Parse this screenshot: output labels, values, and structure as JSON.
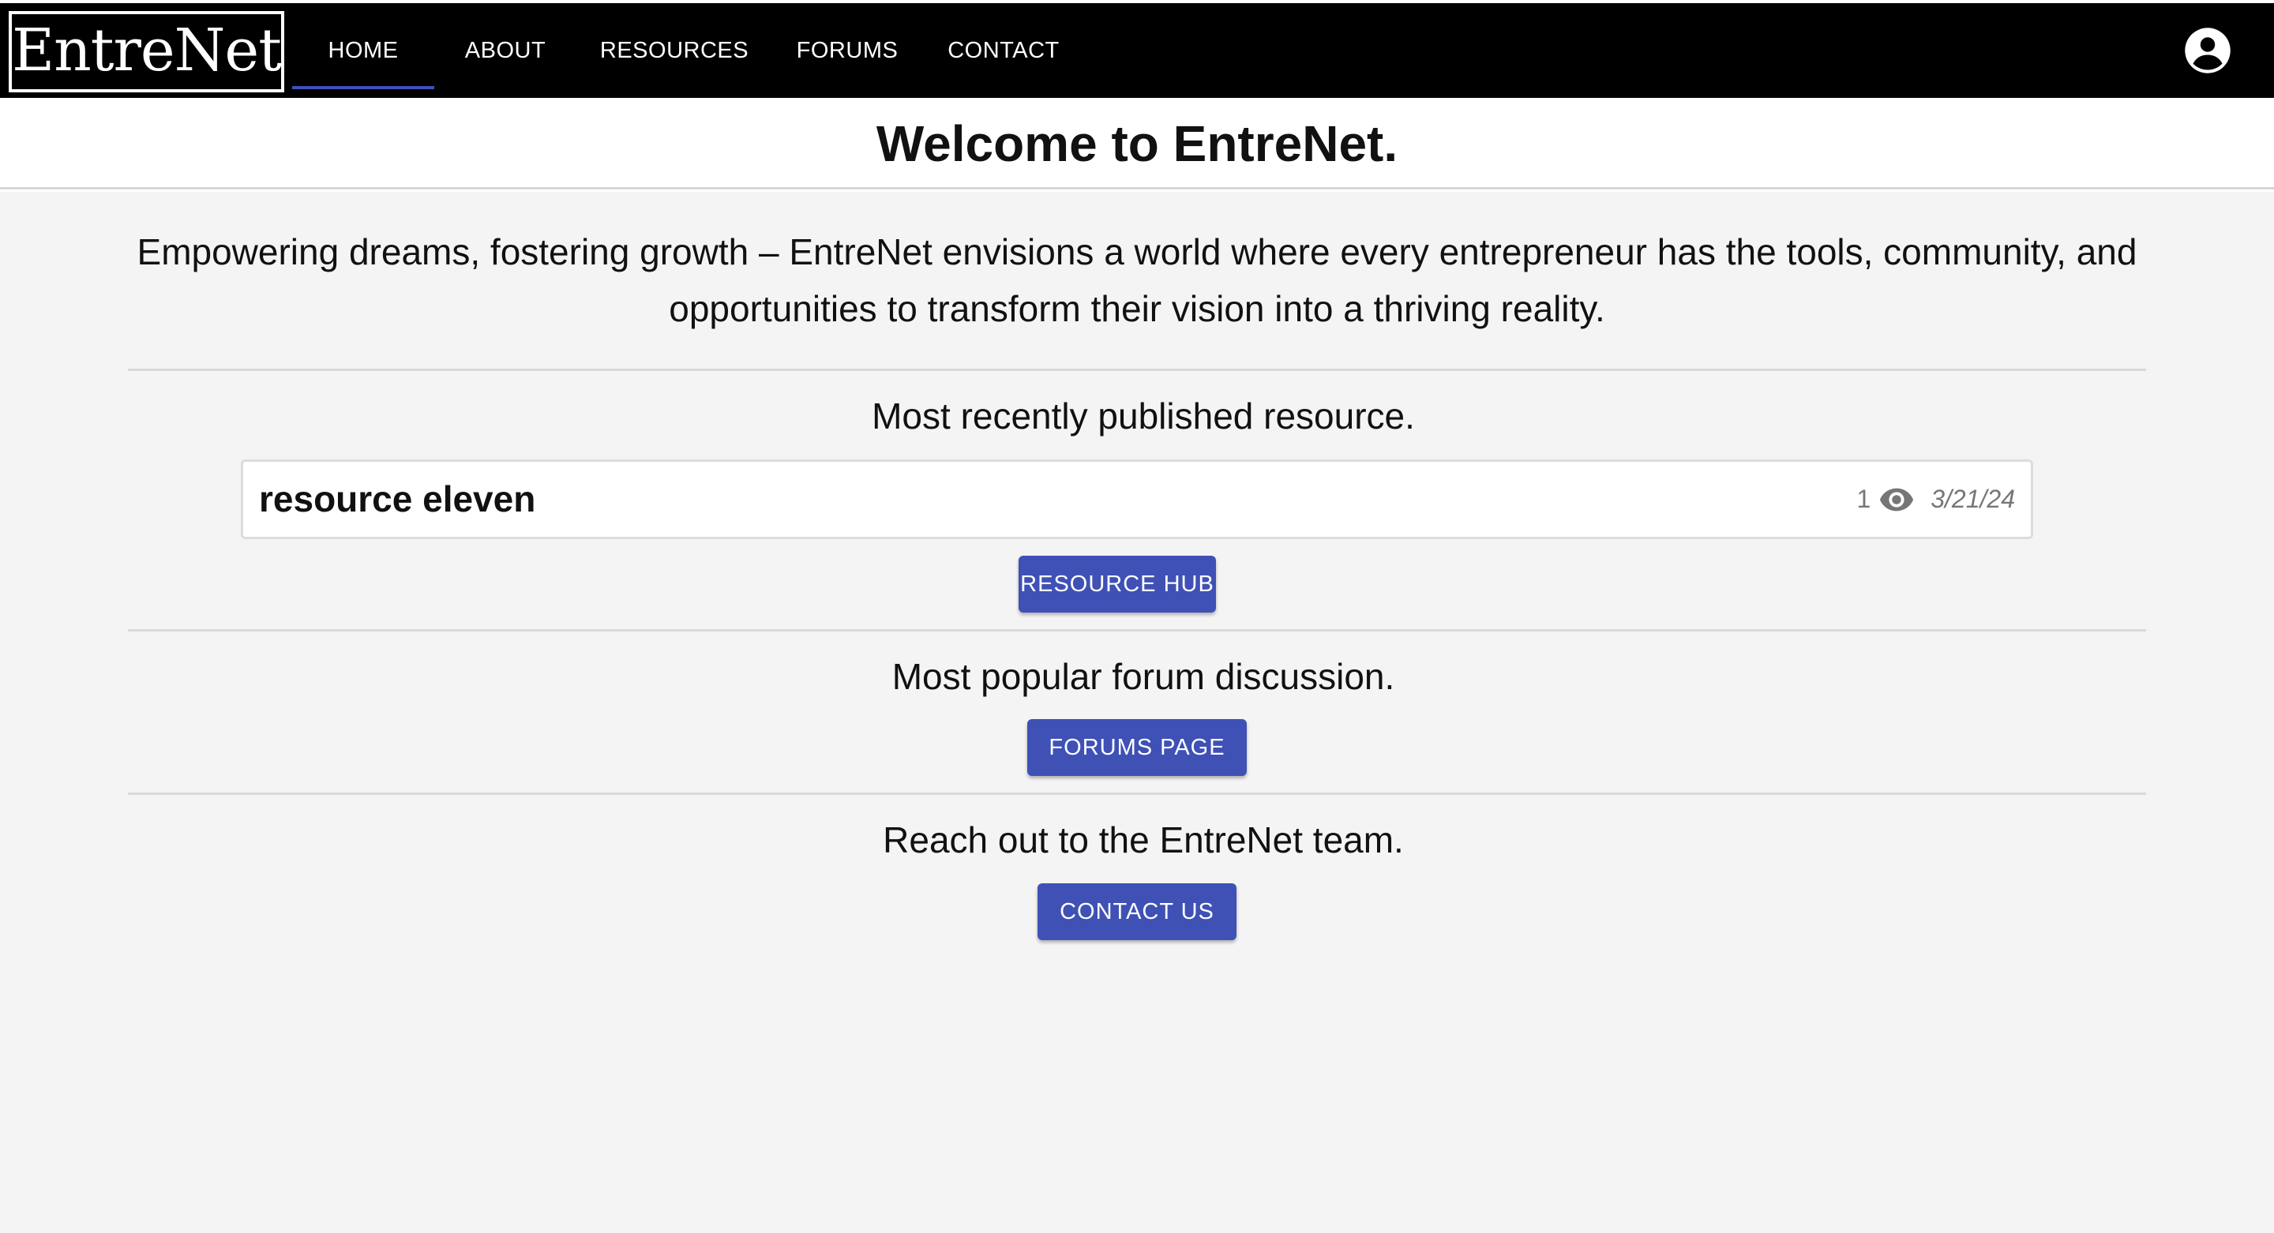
{
  "nav": {
    "logo": "EntreNet",
    "items": [
      "HOME",
      "ABOUT",
      "RESOURCES",
      "FORUMS",
      "CONTACT"
    ],
    "active": "HOME"
  },
  "header": {
    "title": "Welcome to EntreNet."
  },
  "main": {
    "mission": "Empowering dreams, fostering growth – EntreNet envisions a world where every entrepreneur has the tools, community, and opportunities to transform their vision into a thriving reality.",
    "recent_resource": {
      "heading": "Most recently published resource.",
      "title": "resource eleven",
      "views": "1",
      "date": "3/21/24",
      "button": "RESOURCE HUB"
    },
    "forum": {
      "heading": "Most popular forum discussion.",
      "button": "FORUMS PAGE"
    },
    "contact": {
      "heading": "Reach out to the EntreNet team.",
      "button": "CONTACT US"
    }
  },
  "icons": {
    "account": "account-circle-icon",
    "views": "eye-icon"
  },
  "colors": {
    "nav_background": "#000000",
    "accent": "#3f51b5",
    "page_background": "#f4f4f4"
  }
}
